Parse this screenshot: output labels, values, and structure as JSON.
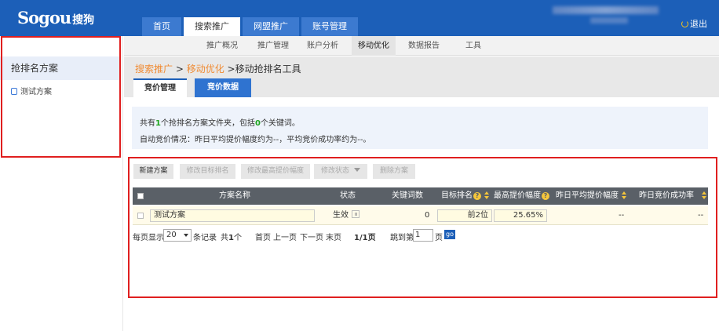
{
  "header": {
    "logo_main": "Sogou",
    "logo_cn": "搜狗",
    "logout": "退出"
  },
  "main_tabs": [
    {
      "label": "首页",
      "active": false
    },
    {
      "label": "搜索推广",
      "active": true
    },
    {
      "label": "网盟推广",
      "active": false
    },
    {
      "label": "账号管理",
      "active": false
    }
  ],
  "sub_nav": [
    {
      "label": "推广概况",
      "active": false
    },
    {
      "label": "推广管理",
      "active": false
    },
    {
      "label": "账户分析",
      "active": false
    },
    {
      "label": "移动优化",
      "active": true
    },
    {
      "label": "数据报告",
      "active": false
    },
    {
      "label": "工具",
      "active": false
    }
  ],
  "sidebar": {
    "title": "抢排名方案",
    "item": "测试方案"
  },
  "breadcrumb": {
    "part1": "搜索推广",
    "sep1": " > ",
    "part2": "移动优化",
    "sep2": " >",
    "part3": "移动抢排名工具"
  },
  "tabs": {
    "bid_manage": "竞价管理",
    "bid_data": "竞价数据"
  },
  "info": {
    "l1_a": "共有",
    "l1_count1": "1",
    "l1_b": "个抢排名方案文件夹，包括",
    "l1_count2": "0",
    "l1_c": "个关键词。",
    "line2": "自动竞价情况：昨日平均提价幅度约为--，平均竞价成功率约为--。"
  },
  "toolbar": {
    "new": "新建方案",
    "edit_rank": "修改目标排名",
    "edit_max": "修改最高提价幅度",
    "edit_status": "修改状态",
    "delete": "删除方案"
  },
  "table": {
    "headers": {
      "name": "方案名称",
      "status": "状态",
      "keywords": "关键词数",
      "target": "目标排名",
      "max_raise": "最高提价幅度",
      "avg_raise": "昨日平均提价幅度",
      "success": "昨日竞价成功率"
    },
    "rows": [
      {
        "name": "测试方案",
        "status": "生效",
        "keywords": "0",
        "target": "前2位",
        "max_raise": "25.65%",
        "avg_raise": "--",
        "success": "--"
      }
    ]
  },
  "pager": {
    "per_page_label": "每页显示",
    "per_page_value": "20",
    "records_label": "条记录",
    "total_a": "共",
    "total_n": "1",
    "total_b": "个",
    "first": "首页",
    "prev": "上一页",
    "next": "下一页",
    "last": "末页",
    "page_info": "1/1页",
    "jump_label": "跳到第",
    "jump_value": "1",
    "page_suffix": "页",
    "go": "go"
  },
  "colors": {
    "brand_blue": "#1c5fb8",
    "highlight_red": "#e01f1f",
    "count_green": "#1ea41e",
    "link_orange": "#f08b33"
  }
}
